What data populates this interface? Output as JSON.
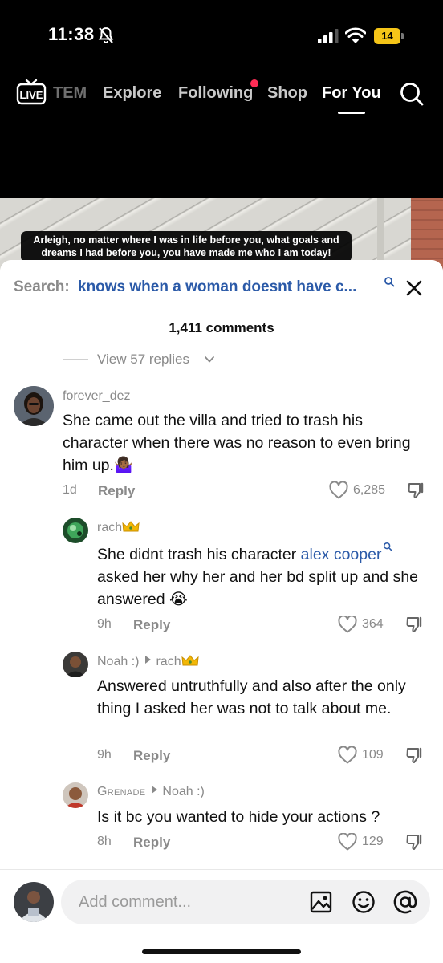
{
  "status_bar": {
    "time": "11:38",
    "battery": "14",
    "battery_color": "#f5c518"
  },
  "top_nav": {
    "tabs": [
      "TEM",
      "Explore",
      "Following",
      "Shop",
      "For You"
    ],
    "active_tab": "For You",
    "notification_dot_color": "#fe2c55"
  },
  "video": {
    "caption_line1": "Arleigh, no matter where I was in life before you, what goals and",
    "caption_line2": "dreams I had before you, you have made me who I am today!"
  },
  "comments_sheet": {
    "search_label": "Search:",
    "search_query": "knows when a woman doesnt have c...",
    "comment_count": "1,411 comments",
    "view_replies_label": "View 57 replies",
    "comments": [
      {
        "username": "forever_dez",
        "text": "She came out the villa and tried to trash his character when there was no reason to even bring him up.🤷🏾‍♀️",
        "time": "1d",
        "reply_label": "Reply",
        "likes": "6,285"
      },
      {
        "username": "rach",
        "text_before_mention": "She didnt trash his character ",
        "mention": "alex cooper",
        "text_after_mention": " asked her why her and her bd split up and she answered 😭",
        "time": "9h",
        "reply_label": "Reply",
        "likes": "364"
      },
      {
        "username": "Noah :)",
        "reply_to": "rach",
        "text": "Answered untruthfully and also after the only thing I asked her was not to talk about me.",
        "time": "9h",
        "reply_label": "Reply",
        "likes": "109"
      },
      {
        "username": "Grenade",
        "reply_to": "Noah :)",
        "text": "Is it bc you wanted to hide your actions ?",
        "time": "8h",
        "reply_label": "Reply",
        "likes": "129"
      }
    ],
    "input_placeholder": "Add comment...",
    "accent_color": "#2b5aa8"
  }
}
